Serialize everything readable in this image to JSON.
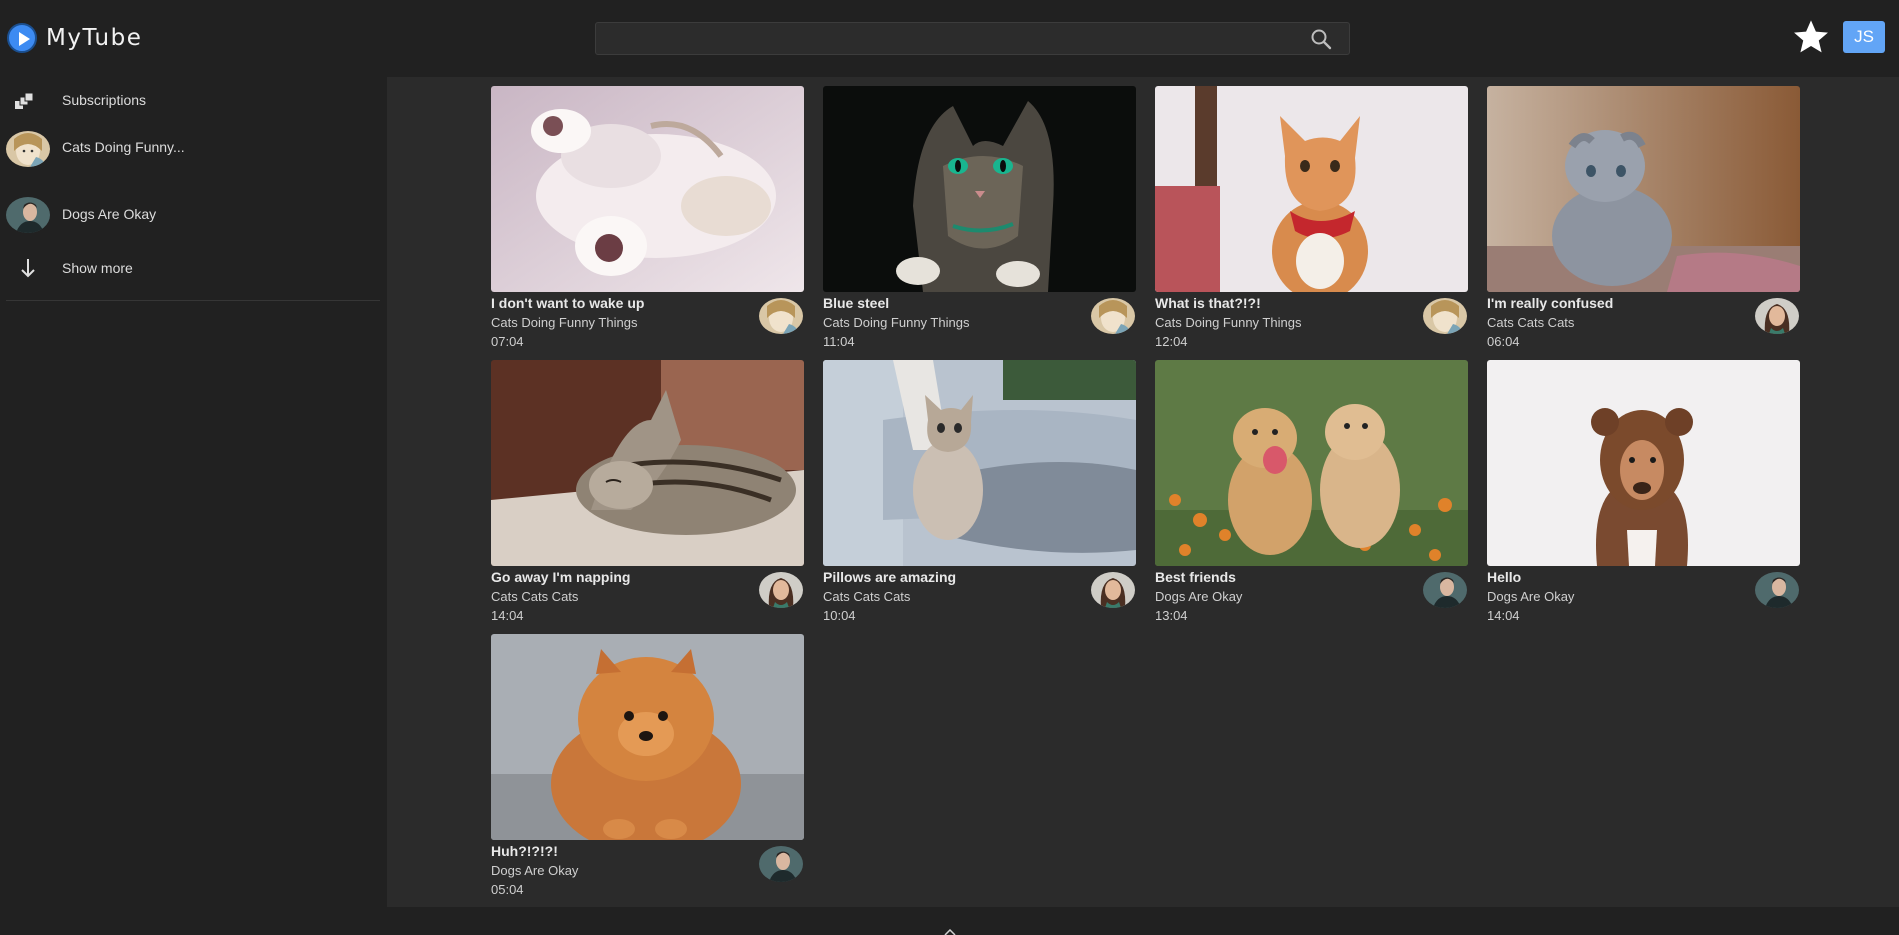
{
  "app": {
    "name": "MyTube",
    "user_initials": "JS"
  },
  "search": {
    "value": "",
    "placeholder": ""
  },
  "sidebar": {
    "items": [
      {
        "label": "Subscriptions",
        "icon": "subscriptions-icon"
      },
      {
        "label": "Cats Doing Funny...",
        "icon": "channel-avatar"
      },
      {
        "label": "Dogs Are Okay",
        "icon": "channel-avatar"
      },
      {
        "label": "Show more",
        "icon": "arrow-down-icon"
      }
    ]
  },
  "videos": [
    {
      "title": "I don't want to wake up",
      "channel": "Cats Doing Funny Things",
      "time": "07:04"
    },
    {
      "title": "Blue steel",
      "channel": "Cats Doing Funny Things",
      "time": "11:04"
    },
    {
      "title": "What is that?!?!",
      "channel": "Cats Doing Funny Things",
      "time": "12:04"
    },
    {
      "title": "I'm really confused",
      "channel": "Cats Cats Cats",
      "time": "06:04"
    },
    {
      "title": "Go away I'm napping",
      "channel": "Cats Cats Cats",
      "time": "14:04"
    },
    {
      "title": "Pillows are amazing",
      "channel": "Cats Cats Cats",
      "time": "10:04"
    },
    {
      "title": "Best friends",
      "channel": "Dogs Are Okay",
      "time": "13:04"
    },
    {
      "title": "Hello",
      "channel": "Dogs Are Okay",
      "time": "14:04"
    },
    {
      "title": "Huh?!?!?!",
      "channel": "Dogs Are Okay",
      "time": "05:04"
    }
  ],
  "colors": {
    "accent": "#3d8bf2",
    "avatar_bg": "#62a5f6",
    "background": "#212121",
    "main_background": "#2b2b2b"
  }
}
